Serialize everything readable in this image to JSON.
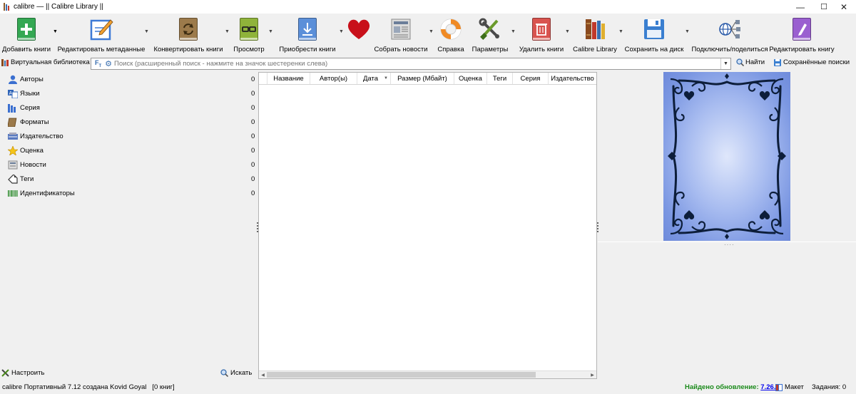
{
  "window": {
    "title": "calibre — || Calibre Library ||",
    "controls": {
      "minimize": "—",
      "maximize": "☐",
      "close": "✕"
    }
  },
  "toolbar": {
    "items": [
      {
        "label": "Добавить книги",
        "icon": "add-book-icon"
      },
      {
        "label": "Редактировать метаданные",
        "icon": "edit-metadata-icon"
      },
      {
        "label": "Конвертировать книги",
        "icon": "convert-books-icon"
      },
      {
        "label": "Просмотр",
        "icon": "view-book-icon"
      },
      {
        "label": "Приобрести книги",
        "icon": "get-books-icon"
      },
      {
        "label": "",
        "icon": "heart-icon"
      },
      {
        "label": "Собрать новости",
        "icon": "fetch-news-icon"
      },
      {
        "label": "Справка",
        "icon": "help-lifebuoy-icon"
      },
      {
        "label": "Параметры",
        "icon": "preferences-tools-icon"
      },
      {
        "label": "Удалить книги",
        "icon": "remove-books-icon"
      },
      {
        "label": "Calibre Library",
        "icon": "library-books-icon"
      },
      {
        "label": "Сохранить на диск",
        "icon": "save-disk-icon"
      },
      {
        "label": "Подключить/поделиться",
        "icon": "connect-share-icon"
      },
      {
        "label": "Редактировать книгу",
        "icon": "edit-book-icon"
      }
    ],
    "colors": {
      "green": "#2ea043",
      "blue_book": "#5b8fd9",
      "brown": "#8b6a3e",
      "olive": "#8fb33a",
      "red": "#c0201f",
      "red_book": "#d9534f",
      "purple": "#8a4fc4"
    }
  },
  "search": {
    "virtual_library": "Виртуальная библиотека",
    "placeholder": "Поиск (расширенный поиск - нажмите на значок шестеренки слева)",
    "find": "Найти",
    "saved_searches": "Сохранённые поиски"
  },
  "tag_browser": {
    "items": [
      {
        "label": "Авторы",
        "count": "0",
        "icon": "authors-icon"
      },
      {
        "label": "Языки",
        "count": "0",
        "icon": "languages-icon"
      },
      {
        "label": "Серия",
        "count": "0",
        "icon": "series-icon"
      },
      {
        "label": "Форматы",
        "count": "0",
        "icon": "formats-icon"
      },
      {
        "label": "Издательство",
        "count": "0",
        "icon": "publisher-icon"
      },
      {
        "label": "Оценка",
        "count": "0",
        "icon": "rating-star-icon"
      },
      {
        "label": "Новости",
        "count": "0",
        "icon": "news-icon"
      },
      {
        "label": "Теги",
        "count": "0",
        "icon": "tags-icon"
      },
      {
        "label": "Идентификаторы",
        "count": "0",
        "icon": "identifiers-icon"
      }
    ],
    "configure": "Настроить",
    "find": "Искать"
  },
  "book_list": {
    "columns": [
      "Название",
      "Автор(ы)",
      "Дата",
      "Размер (Мбайт)",
      "Оценка",
      "Теги",
      "Серия",
      "Издательство"
    ],
    "sort_column": "Дата"
  },
  "status": {
    "left": "calibre Портативный 7.12 создана Kovid Goyal   [0 книг]",
    "update_label": "Найдено обновление:",
    "update_version": "7.26.0",
    "layout": "Макет",
    "jobs": "Задания: 0"
  }
}
